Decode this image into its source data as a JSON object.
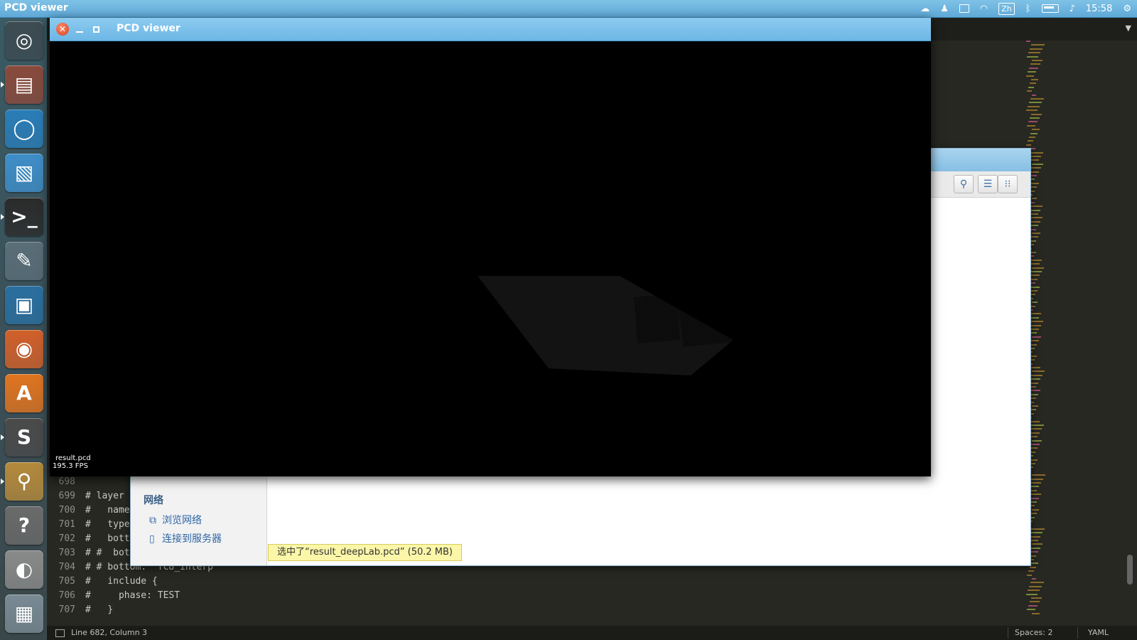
{
  "topbar": {
    "app_title": "PCD viewer",
    "clock": "15:58",
    "input_method": "Zh"
  },
  "launcher": {
    "items": [
      {
        "name": "dash-home",
        "glyph": "◎",
        "bg": "#3d4b52"
      },
      {
        "name": "files",
        "glyph": "▤",
        "bg": "#8a4a3c"
      },
      {
        "name": "chromium",
        "glyph": "◯",
        "bg": "#2a7db8"
      },
      {
        "name": "libreoffice-writer",
        "glyph": "▧",
        "bg": "#3f8ec9"
      },
      {
        "name": "terminal",
        "glyph": ">_",
        "bg": "#2b2b2b"
      },
      {
        "name": "system-settings",
        "glyph": "✎",
        "bg": "#5a6e78"
      },
      {
        "name": "image-viewer",
        "glyph": "▣",
        "bg": "#2a6fa0"
      },
      {
        "name": "firefox",
        "glyph": "◉",
        "bg": "#d2602a"
      },
      {
        "name": "software-center",
        "glyph": "A",
        "bg": "#e0741f"
      },
      {
        "name": "sublime-text",
        "glyph": "S",
        "bg": "#4a4a4a"
      },
      {
        "name": "image-search",
        "glyph": "⚲",
        "bg": "#b48a3c"
      },
      {
        "name": "help",
        "glyph": "?",
        "bg": "#6a6a6a"
      },
      {
        "name": "disk-drive",
        "glyph": "◐",
        "bg": "#8a8a8a"
      },
      {
        "name": "workspace-switcher",
        "glyph": "▦",
        "bg": "#7a8a94"
      }
    ]
  },
  "pcd_window": {
    "title": "PCD viewer",
    "cloud_name": "result.pcd",
    "fps": "195.3 FPS"
  },
  "file_manager": {
    "network_heading": "网络",
    "browse_network": "浏览网络",
    "connect_server": "连接到服务器",
    "selection_status": "选中了“result_deepLab.pcd” (50.2 MB)"
  },
  "editor": {
    "lines": [
      {
        "n": "698",
        "text": ""
      },
      {
        "n": "699",
        "text": "# layer {"
      },
      {
        "n": "700",
        "text": "#   name"
      },
      {
        "n": "701",
        "text": "#   type:"
      },
      {
        "n": "702",
        "text": "#   botto"
      },
      {
        "n": "703",
        "text": "# #  bott"
      },
      {
        "n": "704",
        "text": "# # bottom: \"fc8_interp\""
      },
      {
        "n": "705",
        "text": "#   include {"
      },
      {
        "n": "706",
        "text": "#     phase: TEST"
      },
      {
        "n": "707",
        "text": "#   }"
      }
    ],
    "status_position": "Line 682, Column 3",
    "status_spaces": "Spaces: 2",
    "status_syntax": "YAML"
  }
}
